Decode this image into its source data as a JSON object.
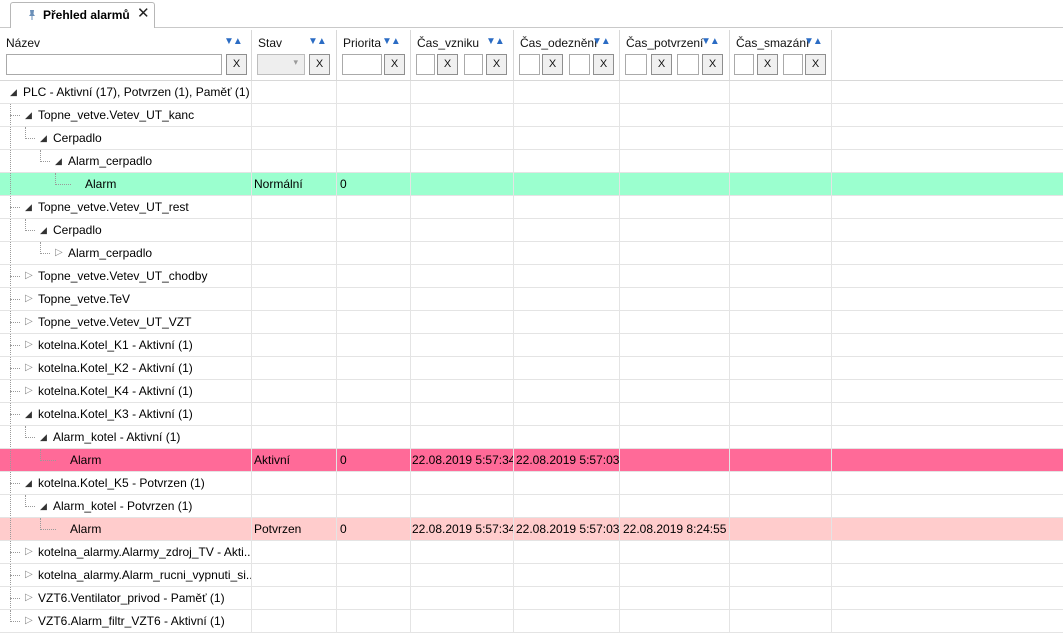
{
  "tab": {
    "title": "Přehled alarmů",
    "close": "✕"
  },
  "columns": {
    "name": "Název",
    "stav": "Stav",
    "priorita": "Priorita",
    "vznik": "Čas_vzniku",
    "odezneni": "Čas_odeznění",
    "potvrzeni": "Čas_potvrzení",
    "smazani": "Čas_smazání",
    "sort_glyph": "▼▲",
    "clear_label": "X"
  },
  "rows": [
    {
      "name": "PLC - Aktivní (17), Potvrzen (1), Paměť (1)",
      "level": 0,
      "toggle": "expanded"
    },
    {
      "name": "Topne_vetve.Vetev_UT_kanc",
      "level": 1,
      "toggle": "expanded"
    },
    {
      "name": "Cerpadlo",
      "level": 2,
      "toggle": "expanded"
    },
    {
      "name": "Alarm_cerpadlo",
      "level": 3,
      "toggle": "expanded"
    },
    {
      "name": "Alarm",
      "level": 4,
      "toggle": "none",
      "stav": "Normální",
      "priorita": "0",
      "vznik": "",
      "odezneni": "",
      "potvrzeni": "",
      "style": "green"
    },
    {
      "name": "Topne_vetve.Vetev_UT_rest",
      "level": 1,
      "toggle": "expanded"
    },
    {
      "name": "Cerpadlo",
      "level": 2,
      "toggle": "expanded"
    },
    {
      "name": "Alarm_cerpadlo",
      "level": 3,
      "toggle": "collapsed"
    },
    {
      "name": "Topne_vetve.Vetev_UT_chodby",
      "level": 1,
      "toggle": "collapsed"
    },
    {
      "name": "Topne_vetve.TeV",
      "level": 1,
      "toggle": "collapsed"
    },
    {
      "name": "Topne_vetve.Vetev_UT_VZT",
      "level": 1,
      "toggle": "collapsed"
    },
    {
      "name": "kotelna.Kotel_K1 - Aktivní (1)",
      "level": 1,
      "toggle": "collapsed"
    },
    {
      "name": "kotelna.Kotel_K2 - Aktivní (1)",
      "level": 1,
      "toggle": "collapsed"
    },
    {
      "name": "kotelna.Kotel_K4 - Aktivní (1)",
      "level": 1,
      "toggle": "collapsed"
    },
    {
      "name": "kotelna.Kotel_K3 - Aktivní (1)",
      "level": 1,
      "toggle": "expanded"
    },
    {
      "name": "Alarm_kotel - Aktivní (1)",
      "level": 2,
      "toggle": "expanded"
    },
    {
      "name": "Alarm",
      "level": 3,
      "toggle": "none",
      "stav": "Aktivní",
      "priorita": "0",
      "vznik": "22.08.2019 5:57:34",
      "odezneni": "22.08.2019 5:57:03",
      "potvrzeni": "",
      "style": "red"
    },
    {
      "name": "kotelna.Kotel_K5 - Potvrzen (1)",
      "level": 1,
      "toggle": "expanded"
    },
    {
      "name": "Alarm_kotel - Potvrzen (1)",
      "level": 2,
      "toggle": "expanded"
    },
    {
      "name": "Alarm",
      "level": 3,
      "toggle": "none",
      "stav": "Potvrzen",
      "priorita": "0",
      "vznik": "22.08.2019 5:57:34",
      "odezneni": "22.08.2019 5:57:03",
      "potvrzeni": "22.08.2019 8:24:55",
      "style": "pink"
    },
    {
      "name": "kotelna_alarmy.Alarmy_zdroj_TV - Akti...",
      "level": 1,
      "toggle": "collapsed"
    },
    {
      "name": "kotelna_alarmy.Alarm_rucni_vypnuti_si...",
      "level": 1,
      "toggle": "collapsed"
    },
    {
      "name": "VZT6.Ventilator_privod - Paměť (1)",
      "level": 1,
      "toggle": "collapsed"
    },
    {
      "name": "VZT6.Alarm_filtr_VZT6 - Aktivní (1)",
      "level": 1,
      "toggle": "collapsed"
    }
  ],
  "colors": {
    "normal": "#9bffcf",
    "active": "#ff6a98",
    "confirmed": "#ffcccc",
    "sort_arrow": "#2b6cc4"
  }
}
